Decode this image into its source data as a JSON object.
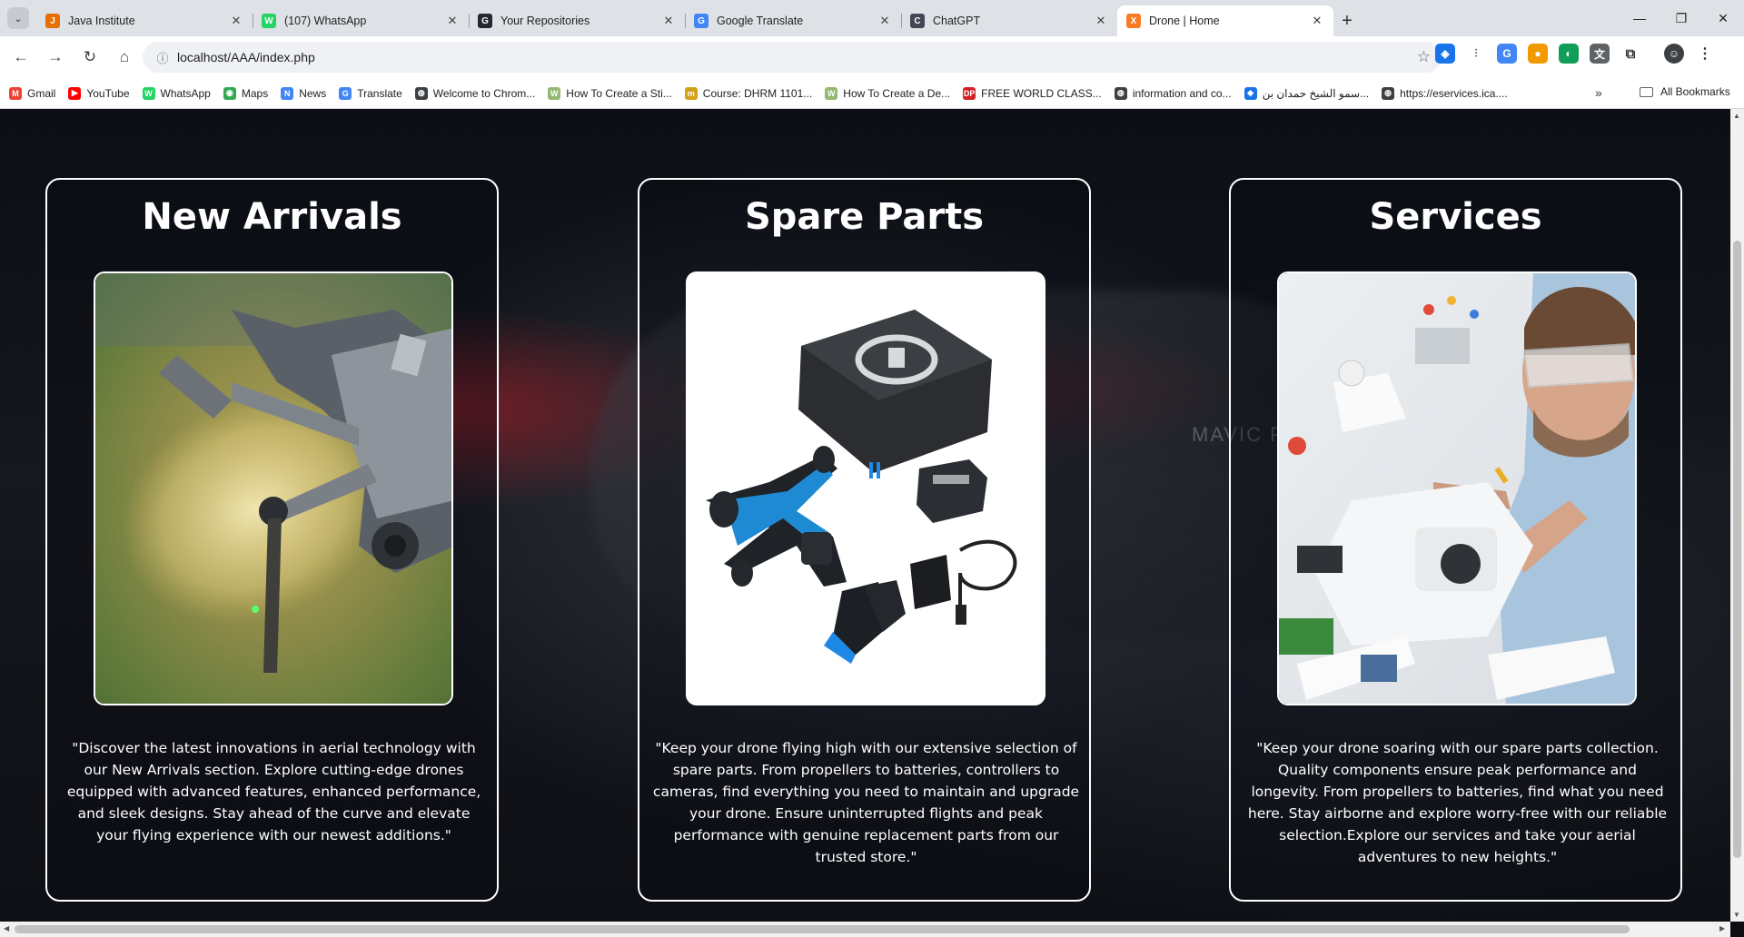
{
  "browser": {
    "tabs": [
      {
        "title": "Java Institute",
        "icon": "java-icon",
        "color": "#e76f00",
        "glyph": "J"
      },
      {
        "title": "(107) WhatsApp",
        "icon": "whatsapp-icon",
        "color": "#25d366",
        "glyph": "W"
      },
      {
        "title": "Your Repositories",
        "icon": "github-icon",
        "color": "#24292f",
        "glyph": "G"
      },
      {
        "title": "Google Translate",
        "icon": "translate-icon",
        "color": "#4285f4",
        "glyph": "G"
      },
      {
        "title": "ChatGPT",
        "icon": "chatgpt-icon",
        "color": "#444654",
        "glyph": "C"
      },
      {
        "title": "Drone | Home",
        "icon": "xampp-icon",
        "color": "#fb7a24",
        "glyph": "X"
      }
    ],
    "active_tab": 5,
    "close_glyph": "✕",
    "new_tab_glyph": "+",
    "url": "localhost/AAA/index.php",
    "bookmarks": [
      {
        "label": "Gmail",
        "icon": "gmail-icon",
        "color": "#ea4335",
        "glyph": "M"
      },
      {
        "label": "YouTube",
        "icon": "youtube-icon",
        "color": "#ff0000",
        "glyph": "▶"
      },
      {
        "label": "WhatsApp",
        "icon": "whatsapp-icon",
        "color": "#25d366",
        "glyph": "W"
      },
      {
        "label": "Maps",
        "icon": "maps-icon",
        "color": "#34a853",
        "glyph": "◉"
      },
      {
        "label": "News",
        "icon": "news-icon",
        "color": "#4285f4",
        "glyph": "N"
      },
      {
        "label": "Translate",
        "icon": "translate-icon",
        "color": "#4285f4",
        "glyph": "G"
      },
      {
        "label": "Welcome to Chrom...",
        "icon": "globe-icon",
        "color": "#3c4043",
        "glyph": "◍"
      },
      {
        "label": "How To Create a Sti...",
        "icon": "wikihow-icon",
        "color": "#93b874",
        "glyph": "W"
      },
      {
        "label": "Course: DHRM 1101...",
        "icon": "course-icon",
        "color": "#d4a017",
        "glyph": "m"
      },
      {
        "label": "How To Create a De...",
        "icon": "wikihow-icon",
        "color": "#93b874",
        "glyph": "W"
      },
      {
        "label": "FREE WORLD CLASS...",
        "icon": "dp-icon",
        "color": "#d21f26",
        "glyph": "DP"
      },
      {
        "label": "information and co...",
        "icon": "globe-icon",
        "color": "#3c4043",
        "glyph": "◍"
      },
      {
        "label": "سمو الشيخ حمدان بن...",
        "icon": "diamond-icon",
        "color": "#1a73e8",
        "glyph": "◆"
      },
      {
        "label": "https://eservices.ica....",
        "icon": "globe-icon",
        "color": "#3c4043",
        "glyph": "◍"
      }
    ],
    "bookmarks_more": "»",
    "all_bookmarks": "All Bookmarks"
  },
  "page": {
    "background_watermark": "MAVIC PRO",
    "cards": [
      {
        "title": "New Arrivals",
        "image": "drone-in-flight-photo",
        "text": "\"Discover the latest innovations in aerial technology with our New Arrivals section. Explore cutting-edge drones equipped with advanced features, enhanced performance, and sleek designs. Stay ahead of the curve and elevate your flying experience with our newest additions.\""
      },
      {
        "title": "Spare Parts",
        "image": "drone-kit-with-case-photo",
        "text": "\"Keep your drone flying high with our extensive selection of spare parts. From propellers to batteries, controllers to cameras, find everything you need to maintain and upgrade your drone. Ensure uninterrupted flights and peak performance with genuine replacement parts from our trusted store.\""
      },
      {
        "title": "Services",
        "image": "technician-repairing-drone-photo",
        "text": "\"Keep your drone soaring with our spare parts collection. Quality components ensure peak performance and longevity. From propellers to batteries, find what you need here. Stay airborne and explore worry-free with our reliable selection.Explore our services and take your aerial adventures to new heights.\""
      }
    ]
  }
}
